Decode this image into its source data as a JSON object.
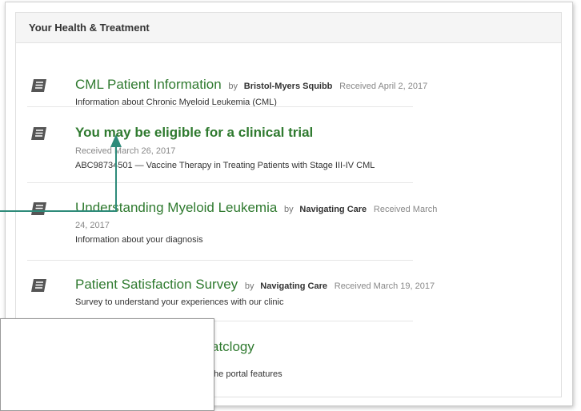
{
  "panel": {
    "title": "Your Health & Treatment"
  },
  "items": [
    {
      "title": "CML Patient Information",
      "by": "by",
      "author": "Bristol-Myers Squibb",
      "received": "Received April 2, 2017",
      "description": "Information about Chronic Myeloid Leukemia (CML)"
    },
    {
      "title": "You may be eligible for a clinical trial",
      "received": "Received March 26, 2017",
      "description": "ABC98734501 — Vaccine Therapy in Treating Patients with Stage III-IV CML"
    },
    {
      "title": "Understanding Myeloid Leukemia",
      "by": "by",
      "author": "Navigating Care",
      "received": "Received March",
      "received_cont": "24, 2017",
      "description": "Information about your diagnosis"
    },
    {
      "title": "Patient Satisfaction Survey",
      "by": "by",
      "author": "Navigating Care",
      "received": "Received March 19, 2017",
      "description": "Survey to understand your experiences with our clinic"
    },
    {
      "title_partial": "atclogy",
      "description_partial": "the portal features"
    }
  ],
  "colors": {
    "link_green": "#2f7a2f",
    "arrow": "#2e8b7a"
  },
  "icons": {
    "item_icon": "book-icon"
  }
}
